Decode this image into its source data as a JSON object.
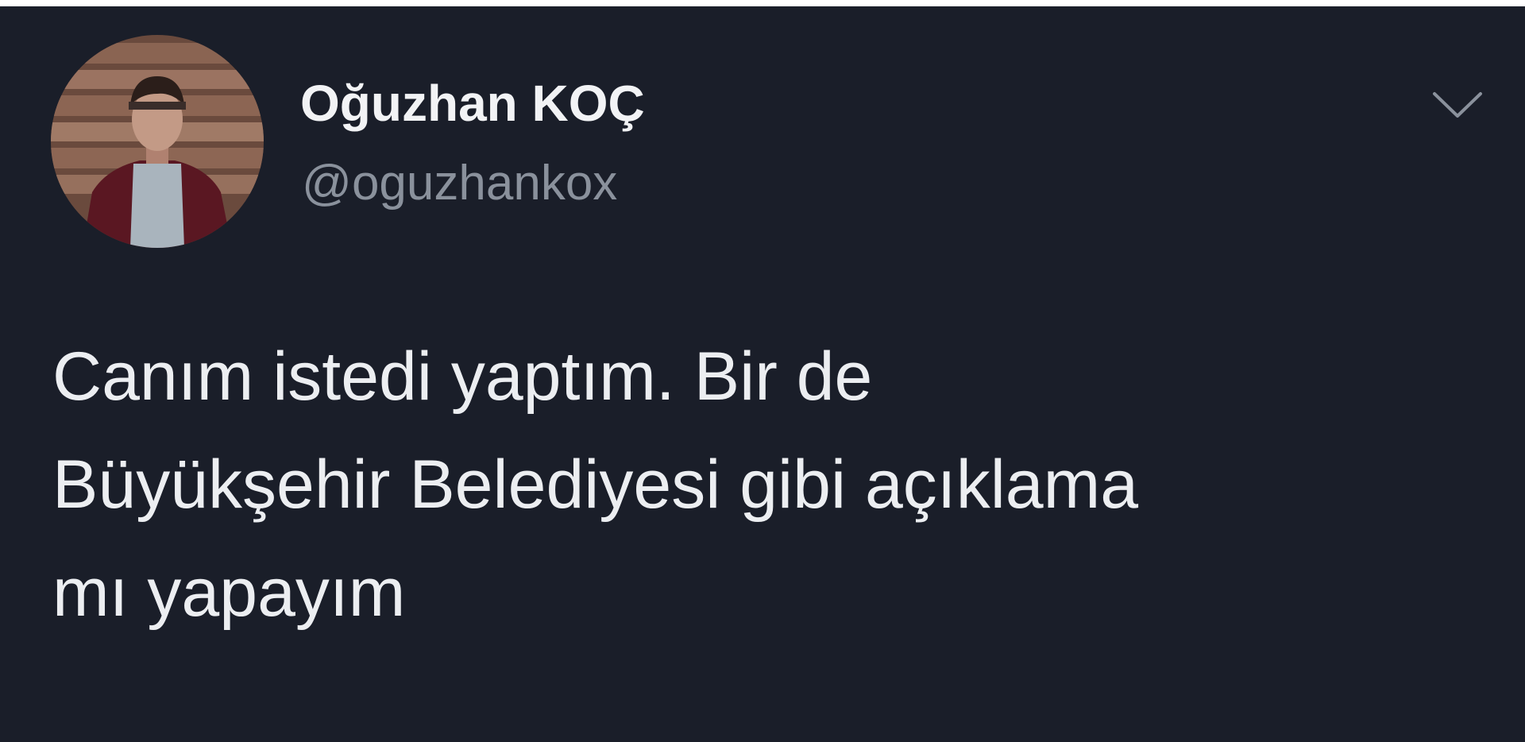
{
  "tweet": {
    "author": {
      "display_name": "Oğuzhan KOÇ",
      "handle": "@oguzhankox",
      "avatar_icon": "profile-photo"
    },
    "menu_icon": "chevron-down-icon",
    "text_lines": [
      "Canım istedi yaptım. Bir de",
      "Büyükşehir Belediyesi gibi açıklama",
      "mı yapayım"
    ]
  },
  "colors": {
    "background": "#1a1e29",
    "name": "#f2f3f5",
    "handle": "#8a919c",
    "body_text": "#eceef1",
    "icon": "#8a919c"
  }
}
